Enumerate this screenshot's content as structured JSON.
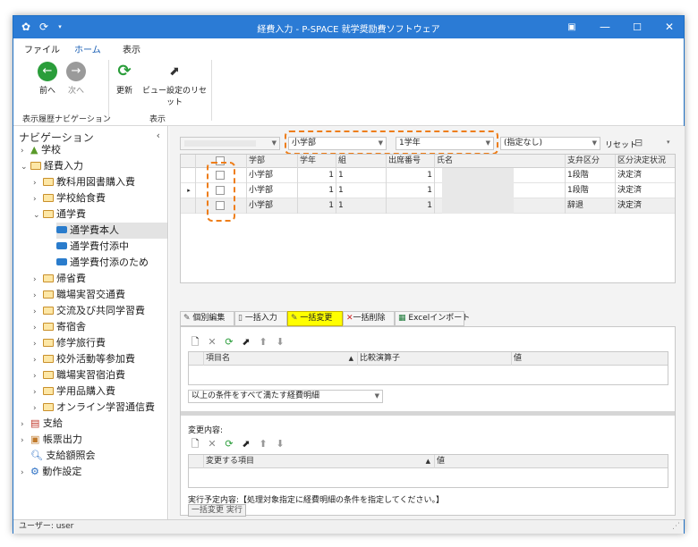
{
  "window": {
    "title": "経費入力 - P-SPACE 就学奨励費ソフトウェア"
  },
  "ribbon": {
    "tabs": [
      "ファイル",
      "ホーム",
      "表示"
    ],
    "back": "前へ",
    "forward": "次へ",
    "refresh": "更新",
    "reset_view": "ビュー設定のリセット",
    "group_history": "表示履歴ナビゲーション",
    "group_view": "表示"
  },
  "nav": {
    "header": "ナビゲーション",
    "items": [
      "学校",
      "経費入力",
      "教科用図書購入費",
      "学校給食費",
      "通学費",
      "通学費本人",
      "通学費付添中",
      "通学費付添のため",
      "帰省費",
      "職場実習交通費",
      "交流及び共同学習費",
      "寄宿舎",
      "修学旅行費",
      "校外活動等参加費",
      "職場実習宿泊費",
      "学用品購入費",
      "オンライン学習通信費",
      "支給",
      "帳票出力",
      "支給額照会",
      "動作設定"
    ]
  },
  "filter": {
    "dept": "小学部",
    "grade": "1学年",
    "none": "(指定なし)",
    "reset": "リセット"
  },
  "grid": {
    "columns": [
      "学部",
      "学年",
      "組",
      "出席番号",
      "氏名",
      "支弁区分",
      "区分決定状況"
    ],
    "rows": [
      [
        "小学部",
        "1",
        "1",
        "1",
        "",
        "1段階",
        "決定済"
      ],
      [
        "小学部",
        "1",
        "1",
        "1",
        "",
        "1段階",
        "決定済"
      ],
      [
        "小学部",
        "1",
        "1",
        "1",
        "",
        "辞退",
        "決定済"
      ]
    ]
  },
  "tabs": [
    "個別編集",
    "一括入力",
    "一括変更",
    "一括削除",
    "Excelインポート"
  ],
  "panel": {
    "cond_cols": [
      "項目名",
      "比較演算子",
      "値"
    ],
    "cond_select": "以上の条件をすべて満たす経費明細",
    "change_label": "変更内容:",
    "change_cols": [
      "変更する項目",
      "値"
    ],
    "plan": "実行予定内容:【処理対象指定に経費明細の条件を指定してください。】",
    "exec": "一括変更 実行"
  },
  "status": {
    "user": "ユーザー: user"
  }
}
